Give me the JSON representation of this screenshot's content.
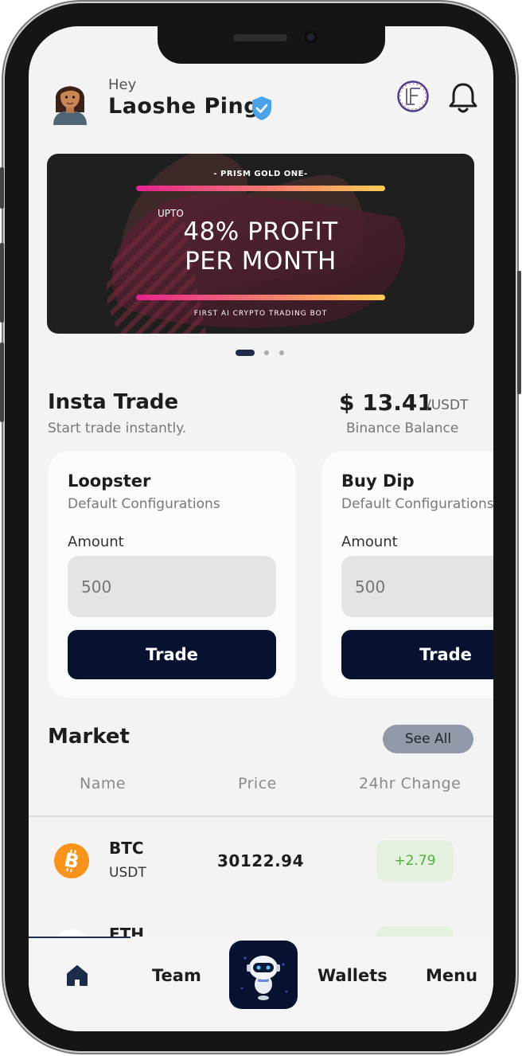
{
  "header": {
    "greeting": "Hey",
    "user_name": "Laoshe Ping"
  },
  "banner": {
    "kicker": "- PRISM GOLD ONE-",
    "upto": "UPTO",
    "headline_line1": "48% PROFIT",
    "headline_line2": "PER MONTH",
    "footer": "FIRST AI CRYPTO TRADING BOT",
    "pages": 3,
    "active_page": 1
  },
  "insta_trade": {
    "title": "Insta Trade",
    "subtitle": "Start trade instantly.",
    "balance_amount": "$ 13.41",
    "balance_unit": "/USDT",
    "balance_label": "Binance Balance",
    "cards": [
      {
        "title": "Loopster",
        "subtitle": "Default Configurations",
        "amount_label": "Amount",
        "amount_value": "500",
        "button_label": "Trade"
      },
      {
        "title": "Buy Dip",
        "subtitle": "Default Configurations",
        "amount_label": "Amount",
        "amount_value": "500",
        "button_label": "Trade"
      }
    ]
  },
  "market": {
    "title": "Market",
    "see_all_label": "See All",
    "columns": [
      "Name",
      "Price",
      "24hr Change"
    ],
    "rows": [
      {
        "symbol": "BTC",
        "quote": "USDT",
        "price": "30122.94",
        "change": "+2.79",
        "icon": "bitcoin-icon"
      },
      {
        "symbol": "ETH",
        "icon": "ethereum-icon"
      }
    ]
  },
  "nav": {
    "items": [
      "Team",
      "Wallets",
      "Menu"
    ],
    "home_icon": "home-icon",
    "center_icon": "robot-icon"
  },
  "colors": {
    "primary_navy": "#061230",
    "positive_green": "#53ad3a",
    "positive_bg": "#e3f1de",
    "btc_orange": "#f7931a",
    "verified_blue": "#4aa3e8"
  }
}
